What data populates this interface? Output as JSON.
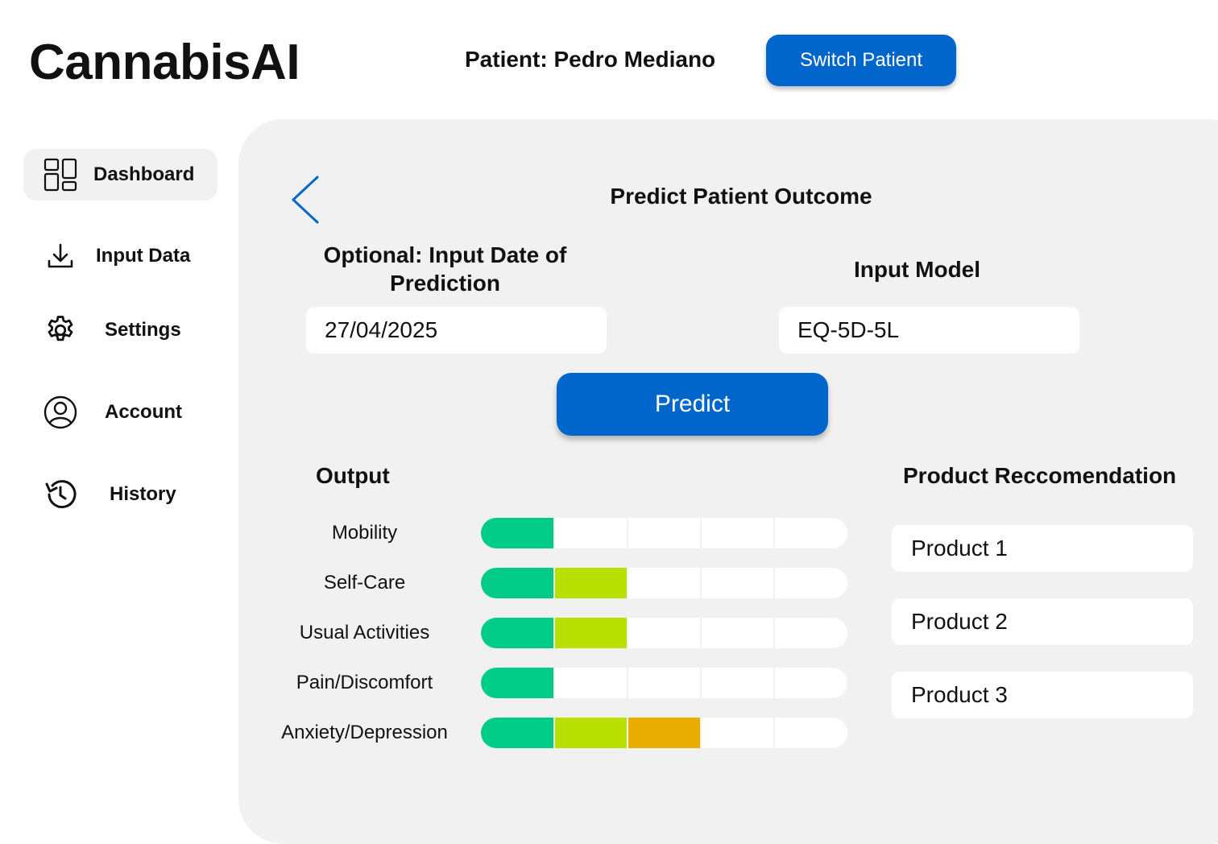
{
  "app": {
    "title": "CannabisAI"
  },
  "header": {
    "patient_label": "Patient: Pedro Mediano",
    "switch_button": "Switch Patient"
  },
  "sidebar": {
    "items": [
      {
        "label": "Dashboard",
        "icon": "dashboard-icon",
        "active": true
      },
      {
        "label": "Input Data",
        "icon": "download-icon",
        "active": false
      },
      {
        "label": "Settings",
        "icon": "gear-icon",
        "active": false
      },
      {
        "label": "Account",
        "icon": "user-icon",
        "active": false
      },
      {
        "label": "History",
        "icon": "history-icon",
        "active": false
      }
    ]
  },
  "main": {
    "title": "Predict Patient Outcome",
    "date_label": "Optional: Input Date of Prediction",
    "date_value": "27/04/2025",
    "model_label": "Input Model",
    "model_value": "EQ-5D-5L",
    "predict_button": "Predict",
    "output_title": "Output",
    "output": [
      {
        "dimension": "Mobility",
        "level": 1
      },
      {
        "dimension": "Self-Care",
        "level": 2
      },
      {
        "dimension": "Usual Activities",
        "level": 2
      },
      {
        "dimension": "Pain/Discomfort",
        "level": 1
      },
      {
        "dimension": "Anxiety/Depression",
        "level": 3
      }
    ],
    "max_level": 5,
    "level_colors": [
      "#00cc88",
      "#b8e000",
      "#e8ad00",
      "#e86a00",
      "#d83030"
    ],
    "recommendation_title": "Product Reccomendation",
    "products": [
      "Product 1",
      "Product 2",
      "Product 3"
    ]
  },
  "colors": {
    "accent": "#0066cc",
    "panel": "#f1f1f1"
  }
}
